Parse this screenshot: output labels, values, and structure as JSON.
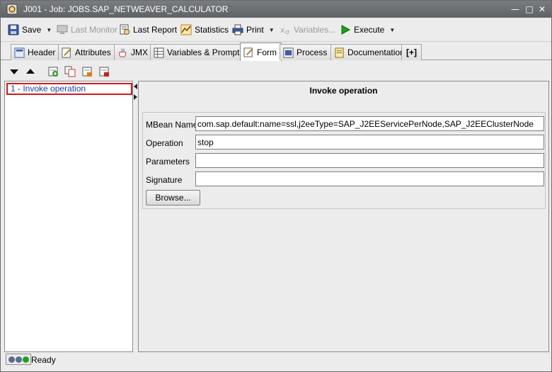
{
  "window": {
    "title": "J001 - Job: JOBS.SAP_NETWEAVER_CALCULATOR"
  },
  "toolbar": {
    "save": "Save",
    "last_monitor": "Last Monitor",
    "last_report": "Last Report",
    "statistics": "Statistics",
    "print": "Print",
    "variables": "Variables...",
    "execute": "Execute"
  },
  "tabs": [
    {
      "label": "Header"
    },
    {
      "label": "Attributes"
    },
    {
      "label": "JMX"
    },
    {
      "label": "Variables & Prompts"
    },
    {
      "label": "Form"
    },
    {
      "label": "Process"
    },
    {
      "label": "Documentation"
    },
    {
      "label": "[+]"
    }
  ],
  "tree": {
    "items": [
      {
        "label": "1 - Invoke operation"
      }
    ]
  },
  "form": {
    "title": "Invoke operation",
    "fields": [
      {
        "label": "MBean Name",
        "value": "com.sap.default:name=ssl,j2eeType=SAP_J2EEServicePerNode,SAP_J2EEClusterNode"
      },
      {
        "label": "Operation",
        "value": "stop"
      },
      {
        "label": "Parameters",
        "value": ""
      },
      {
        "label": "Signature",
        "value": ""
      }
    ],
    "browse": "Browse..."
  },
  "status": {
    "text": "Ready"
  },
  "colors": {
    "selection_border": "#d21a1a",
    "tree_text": "#1a3ea8",
    "execute_green": "#1aa31a"
  }
}
